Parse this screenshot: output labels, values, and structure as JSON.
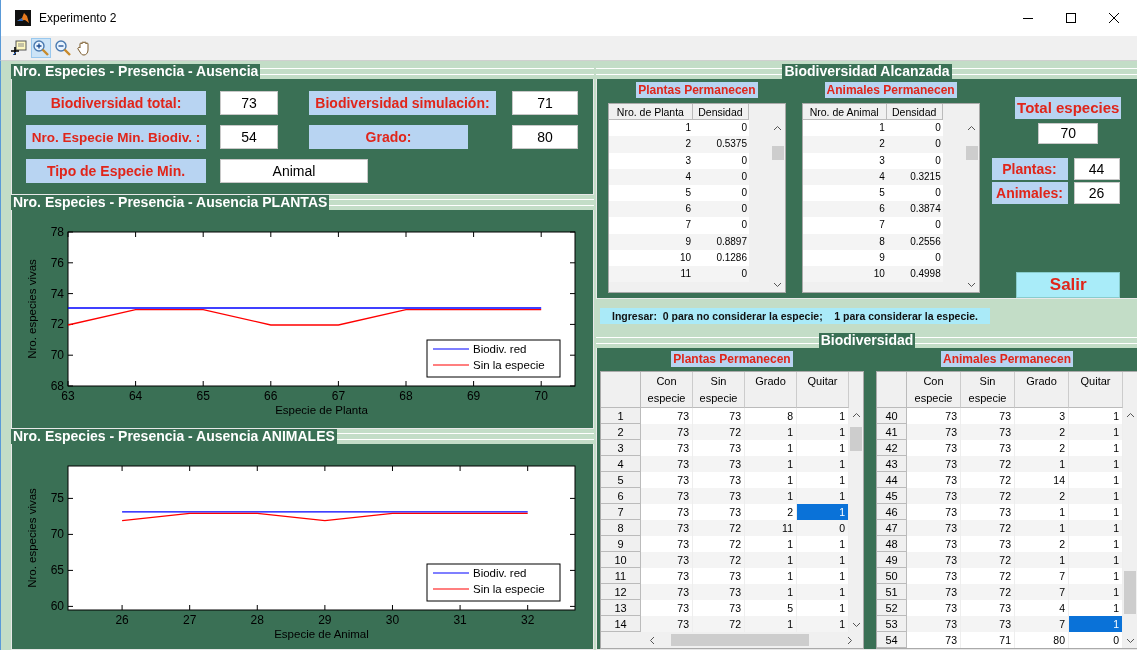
{
  "window": {
    "title": "Experimento 2"
  },
  "toolbar": [
    {
      "kind": "data-cursor",
      "selected": false
    },
    {
      "kind": "zoom-in",
      "selected": true
    },
    {
      "kind": "zoom-out",
      "selected": false
    },
    {
      "kind": "pan",
      "selected": false
    }
  ],
  "summary_panel": {
    "title": "Nro. Especies - Presencia - Ausencia",
    "fields": [
      {
        "label": "Biodiversidad total:",
        "value": "73"
      },
      {
        "label": "Biodiversidad simulación:",
        "value": "71"
      },
      {
        "label": "Nro. Especie Min. Biodiv. :",
        "value": "54"
      },
      {
        "label": "Grado:",
        "value": "80"
      },
      {
        "label": "Tipo de Especie Min.",
        "value": "Animal"
      }
    ]
  },
  "plants_chart_panel": {
    "title": "Nro. Especies - Presencia - Ausencia  PLANTAS",
    "chart_data": {
      "type": "line",
      "xlabel": "Especie de Planta",
      "ylabel": "Nro. especies vivas",
      "x": [
        63,
        64,
        65,
        66,
        67,
        68,
        69,
        70
      ],
      "xlim": [
        63,
        70.5
      ],
      "ylim": [
        68,
        78
      ],
      "xticks": [
        63,
        64,
        65,
        66,
        67,
        68,
        69,
        70
      ],
      "yticks": [
        68,
        70,
        72,
        74,
        76,
        78
      ],
      "legend": "lower right",
      "series": [
        {
          "name": "Biodiv. red",
          "color": "#0000ff",
          "values": [
            73,
            73,
            73,
            73,
            73,
            73,
            73,
            73
          ]
        },
        {
          "name": "Sin la especie",
          "color": "#ff0000",
          "values": [
            72,
            73,
            73,
            72,
            72,
            73,
            73,
            73
          ]
        }
      ]
    }
  },
  "animals_chart_panel": {
    "title": "Nro. Especies - Presencia - Ausencia  ANIMALES",
    "chart_data": {
      "type": "line",
      "xlabel": "Especie de Animal",
      "ylabel": "Nro. especies vivas",
      "x": [
        26,
        27,
        28,
        29,
        30,
        31,
        32
      ],
      "xlim": [
        25.2,
        32.7
      ],
      "ylim": [
        59.5,
        79.5
      ],
      "xticks": [
        26,
        27,
        28,
        29,
        30,
        31,
        32
      ],
      "yticks": [
        60,
        65,
        70,
        75
      ],
      "legend": "lower right",
      "series": [
        {
          "name": "Biodiv. red",
          "color": "#0000ff",
          "values": [
            73,
            73,
            73,
            73,
            73,
            73,
            73
          ]
        },
        {
          "name": "Sin la especie",
          "color": "#ff0000",
          "values": [
            72,
            73,
            73,
            72,
            73,
            73,
            73
          ]
        }
      ]
    }
  },
  "reached_panel": {
    "title": "Biodiversidad Alcanzada",
    "tables": [
      {
        "title": "Plantas Permanecen",
        "columns": [
          "Nro. de Planta",
          "Densidad"
        ],
        "rows": [
          [
            "1",
            "0"
          ],
          [
            "2",
            "0.5375"
          ],
          [
            "3",
            "0"
          ],
          [
            "4",
            "0"
          ],
          [
            "5",
            "0"
          ],
          [
            "6",
            "0"
          ],
          [
            "7",
            "0"
          ],
          [
            "9",
            "0.8897"
          ],
          [
            "10",
            "0.1286"
          ],
          [
            "11",
            "0"
          ]
        ]
      },
      {
        "title": "Animales Permanecen",
        "columns": [
          "Nro. de Animal",
          "Densidad"
        ],
        "rows": [
          [
            "1",
            "0"
          ],
          [
            "2",
            "0"
          ],
          [
            "3",
            "0"
          ],
          [
            "4",
            "0.3215"
          ],
          [
            "5",
            "0"
          ],
          [
            "6",
            "0.3874"
          ],
          [
            "7",
            "0"
          ],
          [
            "8",
            "0.2556"
          ],
          [
            "9",
            "0"
          ],
          [
            "10",
            "0.4998"
          ]
        ]
      }
    ],
    "total_label": "Total especies",
    "total_value": "70",
    "counts": [
      {
        "label": "Plantas:",
        "value": "44"
      },
      {
        "label": "Animales:",
        "value": "26"
      }
    ],
    "exit_button": "Salir"
  },
  "hint": "Ingresar:  0 para no considerar la especie;    1 para considerar la especie.",
  "biodiversity_panel": {
    "title": "Biodiversidad",
    "tables": [
      {
        "title": "Plantas Permanecen",
        "columns": [
          "Con especie",
          "Sin especie",
          "Grado",
          "Quitar"
        ],
        "rows": [
          {
            "number": "1",
            "cells": [
              "73",
              "73",
              "8",
              "1"
            ],
            "selected": false
          },
          {
            "number": "2",
            "cells": [
              "73",
              "72",
              "1",
              "1"
            ],
            "selected": false
          },
          {
            "number": "3",
            "cells": [
              "73",
              "73",
              "1",
              "1"
            ],
            "selected": false
          },
          {
            "number": "4",
            "cells": [
              "73",
              "73",
              "1",
              "1"
            ],
            "selected": false
          },
          {
            "number": "5",
            "cells": [
              "73",
              "73",
              "1",
              "1"
            ],
            "selected": false
          },
          {
            "number": "6",
            "cells": [
              "73",
              "73",
              "1",
              "1"
            ],
            "selected": false
          },
          {
            "number": "7",
            "cells": [
              "73",
              "73",
              "2",
              "1"
            ],
            "selected": true
          },
          {
            "number": "8",
            "cells": [
              "73",
              "72",
              "11",
              "0"
            ],
            "selected": false
          },
          {
            "number": "9",
            "cells": [
              "73",
              "72",
              "1",
              "1"
            ],
            "selected": false
          },
          {
            "number": "10",
            "cells": [
              "73",
              "72",
              "1",
              "1"
            ],
            "selected": false
          },
          {
            "number": "11",
            "cells": [
              "73",
              "73",
              "1",
              "1"
            ],
            "selected": false
          },
          {
            "number": "12",
            "cells": [
              "73",
              "73",
              "1",
              "1"
            ],
            "selected": false
          },
          {
            "number": "13",
            "cells": [
              "73",
              "73",
              "5",
              "1"
            ],
            "selected": false
          },
          {
            "number": "14",
            "cells": [
              "73",
              "72",
              "1",
              "1"
            ],
            "selected": false
          }
        ]
      },
      {
        "title": "Animales Permanecen",
        "columns": [
          "Con especie",
          "Sin especie",
          "Grado",
          "Quitar"
        ],
        "rows": [
          {
            "number": "40",
            "cells": [
              "73",
              "73",
              "3",
              "1"
            ],
            "selected": false
          },
          {
            "number": "41",
            "cells": [
              "73",
              "73",
              "2",
              "1"
            ],
            "selected": false
          },
          {
            "number": "42",
            "cells": [
              "73",
              "73",
              "2",
              "1"
            ],
            "selected": false
          },
          {
            "number": "43",
            "cells": [
              "73",
              "72",
              "1",
              "1"
            ],
            "selected": false
          },
          {
            "number": "44",
            "cells": [
              "73",
              "72",
              "14",
              "1"
            ],
            "selected": false
          },
          {
            "number": "45",
            "cells": [
              "73",
              "72",
              "2",
              "1"
            ],
            "selected": false
          },
          {
            "number": "46",
            "cells": [
              "73",
              "73",
              "1",
              "1"
            ],
            "selected": false
          },
          {
            "number": "47",
            "cells": [
              "73",
              "72",
              "1",
              "1"
            ],
            "selected": false
          },
          {
            "number": "48",
            "cells": [
              "73",
              "73",
              "2",
              "1"
            ],
            "selected": false
          },
          {
            "number": "49",
            "cells": [
              "73",
              "72",
              "1",
              "1"
            ],
            "selected": false
          },
          {
            "number": "50",
            "cells": [
              "73",
              "72",
              "7",
              "1"
            ],
            "selected": false
          },
          {
            "number": "51",
            "cells": [
              "73",
              "72",
              "7",
              "1"
            ],
            "selected": false
          },
          {
            "number": "52",
            "cells": [
              "73",
              "73",
              "4",
              "1"
            ],
            "selected": false
          },
          {
            "number": "53",
            "cells": [
              "73",
              "73",
              "7",
              "1"
            ],
            "selected": true
          },
          {
            "number": "54",
            "cells": [
              "73",
              "71",
              "80",
              "0"
            ],
            "selected": false
          }
        ]
      }
    ]
  }
}
